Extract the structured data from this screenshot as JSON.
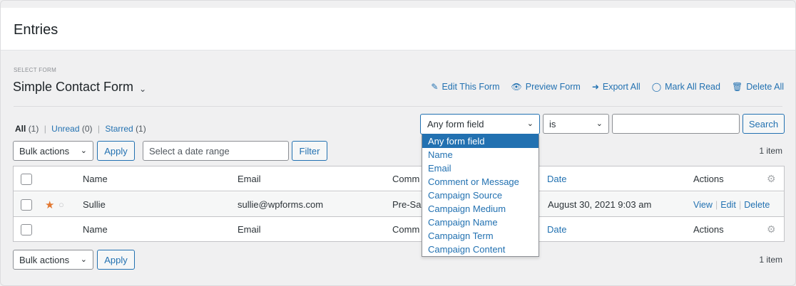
{
  "page": {
    "title": "Entries"
  },
  "form_selector": {
    "label": "SELECT FORM",
    "current": "Simple Contact Form"
  },
  "top_actions": [
    {
      "label": "Edit This Form",
      "icon": "pencil-icon"
    },
    {
      "label": "Preview Form",
      "icon": "eye-icon"
    },
    {
      "label": "Export All",
      "icon": "export-icon"
    },
    {
      "label": "Mark All Read",
      "icon": "circle-icon"
    },
    {
      "label": "Delete All",
      "icon": "trash-icon"
    }
  ],
  "views": {
    "all": "All",
    "all_count": "(1)",
    "unread": "Unread",
    "unread_count": "(0)",
    "starred": "Starred",
    "starred_count": "(1)",
    "sep": "|"
  },
  "filter": {
    "field_value": "Any form field",
    "operator_value": "is",
    "search_value": "",
    "search_label": "Search",
    "options": [
      "Any form field",
      "Name",
      "Email",
      "Comment or Message",
      "Campaign Source",
      "Campaign Medium",
      "Campaign Name",
      "Campaign Term",
      "Campaign Content"
    ]
  },
  "bulk": {
    "label": "Bulk actions",
    "apply": "Apply"
  },
  "date_range": {
    "placeholder": "Select a date range",
    "filter_label": "Filter"
  },
  "item_count": "1 item",
  "table": {
    "headers": {
      "name": "Name",
      "email": "Email",
      "comment": "Comm",
      "date": "Date",
      "actions": "Actions"
    },
    "rows": [
      {
        "name": "Sullie",
        "email": "sullie@wpforms.com",
        "comment": "Pre-Sal",
        "date": "August 30, 2021 9:03 am",
        "view": "View",
        "edit": "Edit",
        "delete": "Delete",
        "sep": "|"
      }
    ]
  },
  "colors": {
    "accent": "#2271b1",
    "star": "#e27730"
  }
}
